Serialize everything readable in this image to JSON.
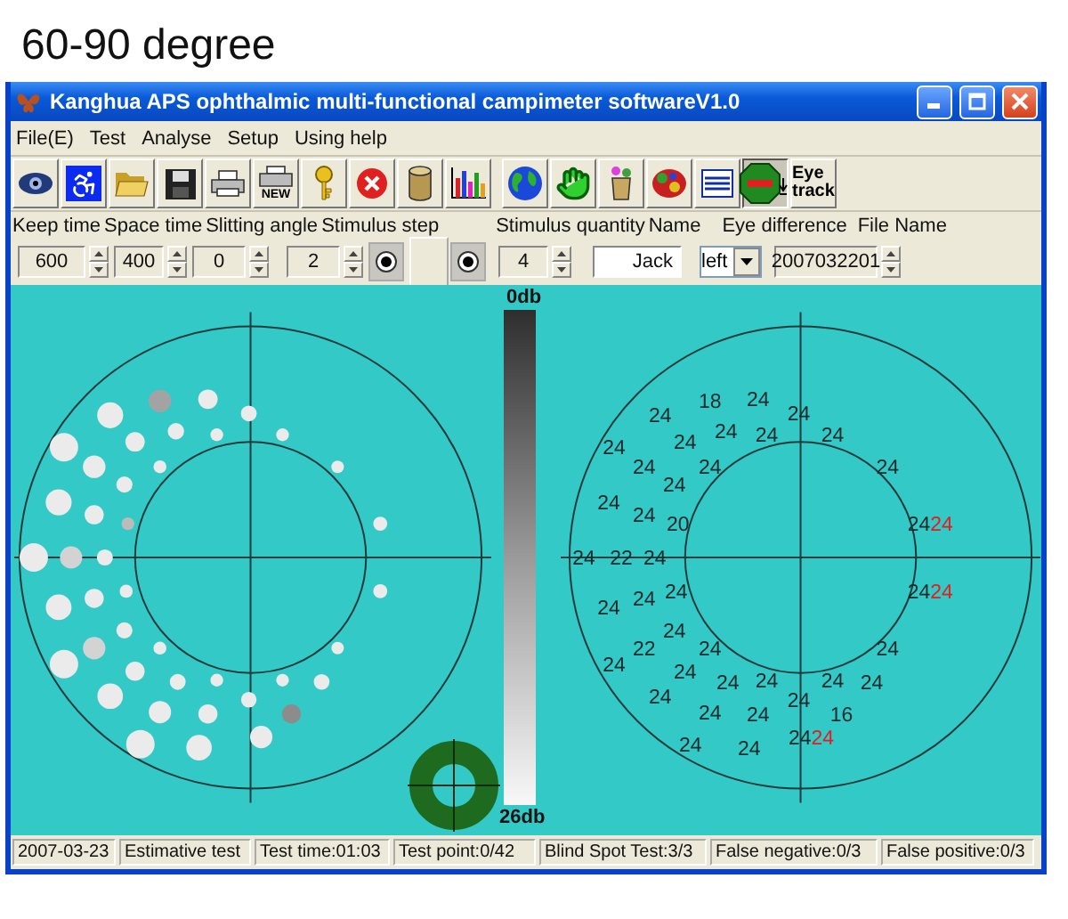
{
  "caption": "60-90 degree",
  "window": {
    "title": "Kanghua APS ophthalmic multi-functional campimeter softwareV1.0"
  },
  "menu": [
    "File(E)",
    "Test",
    "Analyse",
    "Setup",
    "Using help"
  ],
  "toolbar": [
    [
      {
        "pressed": false
      },
      {
        "pressed": false
      },
      {
        "pressed": false
      },
      {
        "pressed": false
      },
      {
        "pressed": false
      },
      {
        "pressed": false,
        "label": "NEW"
      },
      {
        "pressed": false
      },
      {
        "pressed": false
      },
      {
        "pressed": false
      },
      {
        "pressed": false
      }
    ],
    [
      {
        "pressed": false
      },
      {
        "pressed": false
      },
      {
        "pressed": false
      },
      {
        "pressed": false
      },
      {
        "pressed": false
      },
      {
        "pressed": true
      },
      {
        "pressed": false,
        "label": "Eye track"
      }
    ]
  ],
  "parameter_labels": [
    "Keep time",
    "Space time",
    "Slitting angle",
    "Stimulus step",
    "Stimulus quantity",
    "Name",
    "Eye difference",
    "File Name"
  ],
  "parameter_controls": [
    {
      "kind": "spin",
      "value": "600"
    },
    {
      "kind": "spin",
      "value": "400"
    },
    {
      "kind": "spin",
      "value": "0"
    },
    {
      "kind": "spin",
      "value": "2"
    },
    {
      "kind": "radio",
      "selected": true
    },
    {
      "kind": "blank"
    },
    {
      "kind": "radio",
      "selected": true
    },
    {
      "kind": "spin",
      "value": "4"
    },
    {
      "kind": "text",
      "value": "Jack"
    },
    {
      "kind": "select",
      "value": "left"
    },
    {
      "kind": "spin",
      "value": "2007032201"
    }
  ],
  "scale": {
    "top": "0db",
    "bottom": "26db"
  },
  "field_points": [
    {
      "value": "18"
    },
    {
      "value": "24"
    },
    {
      "value": "24"
    },
    {
      "value": "24"
    },
    {
      "value": "24"
    },
    {
      "value": "24"
    },
    {
      "value": "24"
    },
    {
      "value": "24"
    },
    {
      "value": "24"
    },
    {
      "value": "24"
    },
    {
      "value": "24"
    },
    {
      "value": "24"
    },
    {
      "value": "24"
    },
    {
      "value": "24"
    },
    {
      "value": "24"
    },
    {
      "value": "20"
    },
    {
      "value": "24",
      "retest": "24"
    },
    {
      "value": "24"
    },
    {
      "value": "22"
    },
    {
      "value": "24"
    },
    {
      "value": "24"
    },
    {
      "value": "24"
    },
    {
      "value": "24"
    },
    {
      "value": "24",
      "retest": "24"
    },
    {
      "value": "24"
    },
    {
      "value": "22"
    },
    {
      "value": "24"
    },
    {
      "value": "24"
    },
    {
      "value": "24"
    },
    {
      "value": "24"
    },
    {
      "value": "24"
    },
    {
      "value": "24"
    },
    {
      "value": "24"
    },
    {
      "value": "24"
    },
    {
      "value": "24"
    },
    {
      "value": "24"
    },
    {
      "value": "24"
    },
    {
      "value": "24"
    },
    {
      "value": "16"
    },
    {
      "value": "24"
    },
    {
      "value": "24"
    },
    {
      "value": "24",
      "retest": "24"
    }
  ],
  "status_bar": [
    "2007-03-23",
    "Estimative test",
    "Test time:01:03",
    "Test point:0/42",
    "Blind Spot Test:3/3",
    "False negative:0/3",
    "False positive:0/3"
  ]
}
